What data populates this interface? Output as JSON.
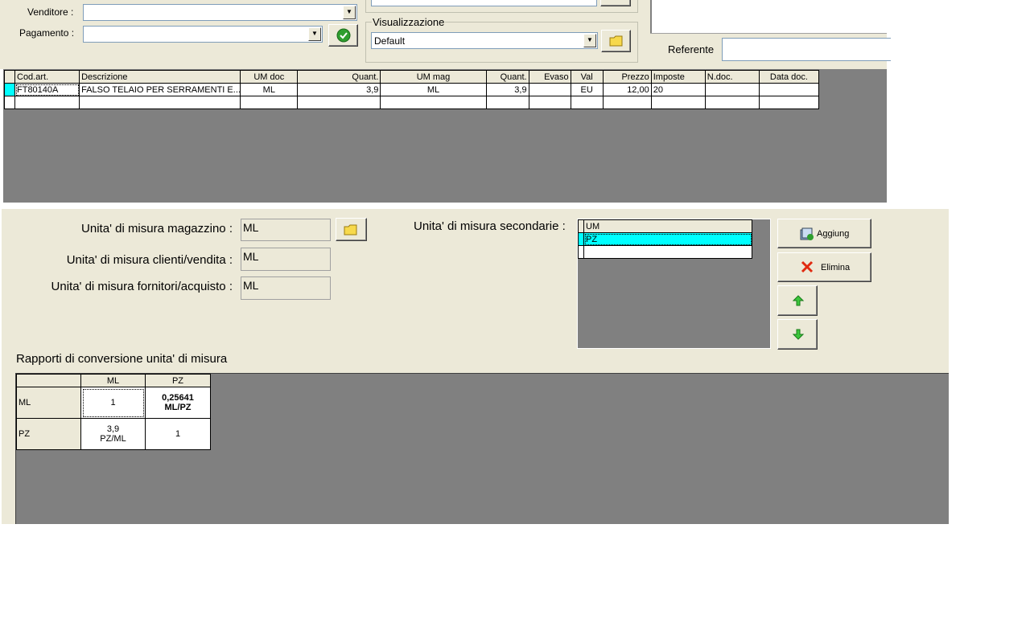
{
  "header": {
    "venditore_label": "Venditore :",
    "pagamento_label": "Pagamento :",
    "visualizzazione_label": "Visualizzazione",
    "visualizzazione_value": "Default",
    "referente_label": "Referente",
    "venditore_value": "",
    "pagamento_value": "",
    "referente_value": ""
  },
  "lines_grid": {
    "columns": [
      "Cod.art.",
      "Descrizione",
      "UM doc",
      "Quant.",
      "UM mag",
      "Quant.",
      "Evaso",
      "Val",
      "Prezzo",
      "Imposte",
      "N.doc.",
      "Data doc."
    ],
    "rows": [
      [
        "FT80140A",
        "FALSO TELAIO PER SERRAMENTI E...",
        "ML",
        "3,9",
        "ML",
        "3,9",
        "",
        "EU",
        "12,00",
        "20",
        "",
        ""
      ],
      [
        "",
        "",
        "",
        "",
        "",
        "",
        "",
        "",
        "",
        "",
        "",
        ""
      ]
    ]
  },
  "um": {
    "magazzino_label": "Unita' di misura magazzino :",
    "magazzino_value": "ML",
    "vendita_label": "Unita' di misura clienti/vendita :",
    "vendita_value": "ML",
    "acquisto_label": "Unita' di misura fornitori/acquisto :",
    "acquisto_value": "ML",
    "secondarie_label": "Unita' di misura secondarie :",
    "secondarie_header": "UM",
    "secondarie_items": [
      "PZ",
      ""
    ],
    "aggiungi_label": "Aggiung",
    "elimina_label": "Elimina"
  },
  "conversion": {
    "title": "Rapporti di conversione unita' di misura",
    "col_headers": [
      "",
      "ML",
      "PZ"
    ],
    "rows": [
      {
        "label": "ML",
        "c1_value": "1",
        "c1_unit": "",
        "c2_value": "0,25641",
        "c2_unit": "ML/PZ"
      },
      {
        "label": "PZ",
        "c1_value": "3,9",
        "c1_unit": "PZ/ML",
        "c2_value": "1",
        "c2_unit": ""
      }
    ]
  },
  "colors": {
    "panel": "#ece9d8",
    "gray": "#808080",
    "selection": "#00ffff"
  }
}
